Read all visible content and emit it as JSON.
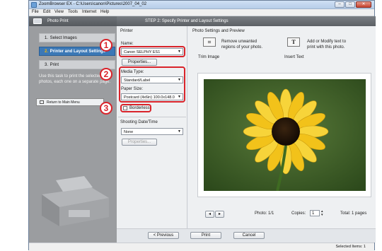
{
  "window": {
    "title": "ZoomBrowser EX - C:\\Users\\canon\\Pictures\\2007_04_02",
    "controls": [
      "–",
      "□",
      "✕"
    ]
  },
  "menu": [
    "File",
    "Edit",
    "View",
    "Tools",
    "Internet",
    "Help"
  ],
  "left_panel": {
    "header": "Photo Print",
    "steps": [
      {
        "num": "1.",
        "label": "Select Images"
      },
      {
        "num": "2.",
        "label": "Printer and Layout Settings"
      },
      {
        "num": "3.",
        "label": "Print"
      }
    ],
    "description": "Use this task to print the selected photos, each one on a separate page.",
    "return_button": "Return to Main Menu"
  },
  "step_header": "STEP 2: Specify Printer and Layout Settings",
  "settings": {
    "printer_section": "Printer",
    "name_label": "Name:",
    "printer_name": "Canon SELPHY ES1",
    "properties_button": "Properties...",
    "media_type_label": "Media Type:",
    "media_type": "Standard/Label",
    "paper_size_label": "Paper Size:",
    "paper_size": "Postcard (4x6in) 100.0x148.0",
    "borderless_label": "Borderless",
    "borderless_checked": false,
    "shooting_section": "Shooting Date/Time",
    "shooting_value": "None",
    "properties2_button": "Properties..."
  },
  "callouts": [
    "1",
    "2",
    "3"
  ],
  "preview": {
    "section_title": "Photo Settings and Preview",
    "trim_label": "Trim Image",
    "trim_desc": "Remove unwanted regions of your photo.",
    "text_label": "Insert Text",
    "text_desc": "Add or Modify text to print with this photo.",
    "photo_label": "Photo: 1/1",
    "copies_label": "Copies:",
    "copies_value": "1",
    "total_label": "Total: 1 pages"
  },
  "buttons": {
    "previous": "< Previous",
    "print": "Print",
    "cancel": "Cancel"
  },
  "status": "Selected Items: 1",
  "colors": {
    "accent": "#3b78b6",
    "callout": "#d9232a",
    "step_num_active": "#f5b400"
  }
}
